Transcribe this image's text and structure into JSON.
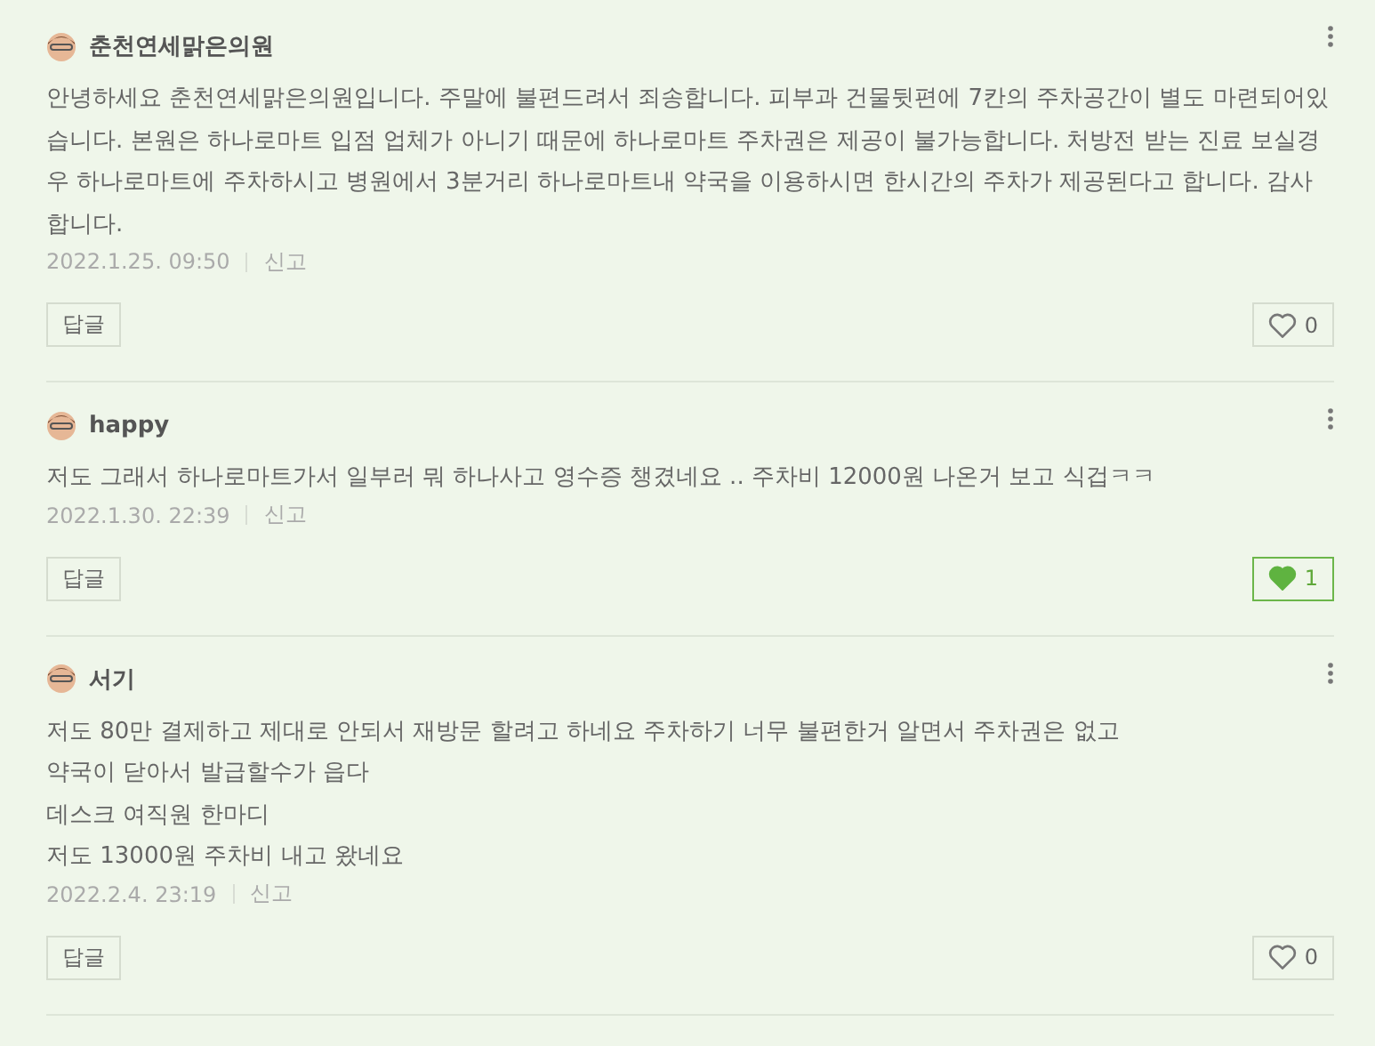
{
  "comments": [
    {
      "author": "춘천연세맑은의원",
      "lines": [
        "안녕하세요 춘천연세맑은의원입니다. 주말에 불편드려서 죄송합니다. 피부과 건물뒷편에 7칸의 주차공간이 별도 마련되어있습니다. 본원은 하나로마트 입점 업체가 아니기 때문에 하나로마트 주차권은 제공이 불가능합니다. 처방전 받는 진료 보실경우 하나로마트에 주차하시고 병원에서 3분거리 하나로마트내 약국을 이용하시면 한시간의 주차가 제공된다고 합니다. 감사합니다."
      ],
      "date": "2022.1.25. 09:50",
      "report": "신고",
      "reply": "답글",
      "likes": "0",
      "liked": false
    },
    {
      "author": "happy",
      "lines": [
        "저도 그래서 하나로마트가서 일부러 뭐 하나사고 영수증 챙겼네요 .. 주차비 12000원 나온거 보고 식겁ㅋㅋ"
      ],
      "date": "2022.1.30. 22:39",
      "report": "신고",
      "reply": "답글",
      "likes": "1",
      "liked": true
    },
    {
      "author": "서기",
      "lines": [
        "저도 80만 결제하고 제대로 안되서 재방문 할려고 하네요 주차하기 너무 불편한거 알면서 주차권은 없고",
        "약국이 닫아서 발급할수가 읍다",
        "데스크 여직원 한마디",
        "저도 13000원 주차비 내고 왔네요"
      ],
      "date": "2022.2.4. 23:19",
      "report": "신고",
      "reply": "답글",
      "likes": "0",
      "liked": false
    }
  ]
}
